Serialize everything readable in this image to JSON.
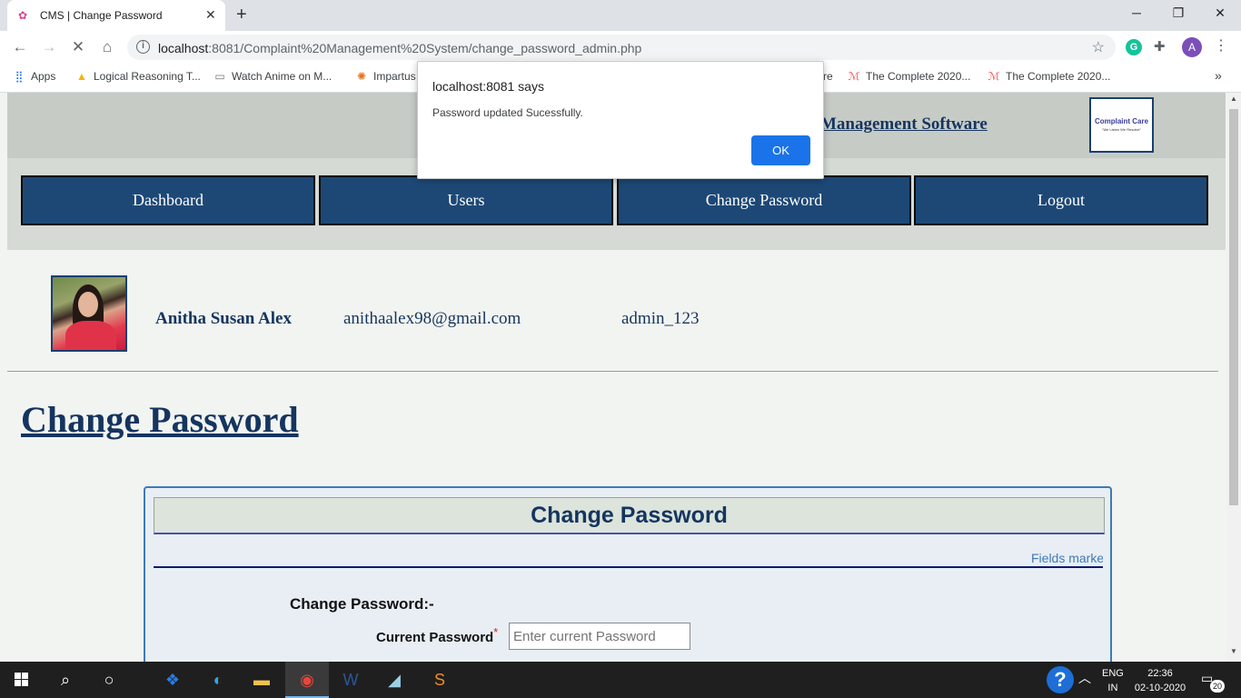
{
  "browser": {
    "tab_title": "CMS | Change Password",
    "tab_favicon": "cms-favicon",
    "tab_close": "✕",
    "new_tab": "+",
    "url_host": "localhost",
    "url_rest": ":8081/Complaint%20Management%20System/change_password_admin.php",
    "profile_initial": "A",
    "grammarly": "G",
    "bookmarks": [
      {
        "icon": "apps-grid-icon",
        "label": "Apps"
      },
      {
        "icon": "drive-icon",
        "label": "Logical Reasoning T..."
      },
      {
        "icon": "page-icon",
        "label": "Watch Anime on M..."
      },
      {
        "icon": "impartus-icon",
        "label": "Impartus"
      },
      {
        "icon": "bookmark-icon",
        "label": "re"
      },
      {
        "icon": "udemy-icon",
        "label": "The Complete 2020..."
      },
      {
        "icon": "udemy-icon",
        "label": "The Complete 2020..."
      }
    ],
    "more_bookmarks": "»"
  },
  "site": {
    "title": "Management Software",
    "logo_text": "Complaint Care",
    "logo_tagline": "\"We Listen We Resolve\""
  },
  "nav": {
    "items": [
      "Dashboard",
      "Users",
      "Change Password",
      "Logout"
    ]
  },
  "profile": {
    "name": "Anitha Susan Alex",
    "email": "anithaalex98@gmail.com",
    "username": "admin_123"
  },
  "page": {
    "heading": "Change Password"
  },
  "form": {
    "header": "Change Password",
    "fields_note": "Fields marked",
    "subheading": "Change Password:-",
    "current_label": "Current Password",
    "required_mark": "*",
    "current_placeholder": "Enter current Password"
  },
  "dialog": {
    "title": "localhost:8081 says",
    "message": "Password updated Sucessfully.",
    "ok_label": "OK"
  },
  "taskbar": {
    "lang_top": "ENG",
    "lang_bottom": "IN",
    "time": "22:36",
    "date": "02-10-2020",
    "notification_count": "20",
    "help": "?"
  },
  "colors": {
    "nav_bg": "#1d4876",
    "heading": "#15355f",
    "dialog_button": "#1a73e8"
  }
}
